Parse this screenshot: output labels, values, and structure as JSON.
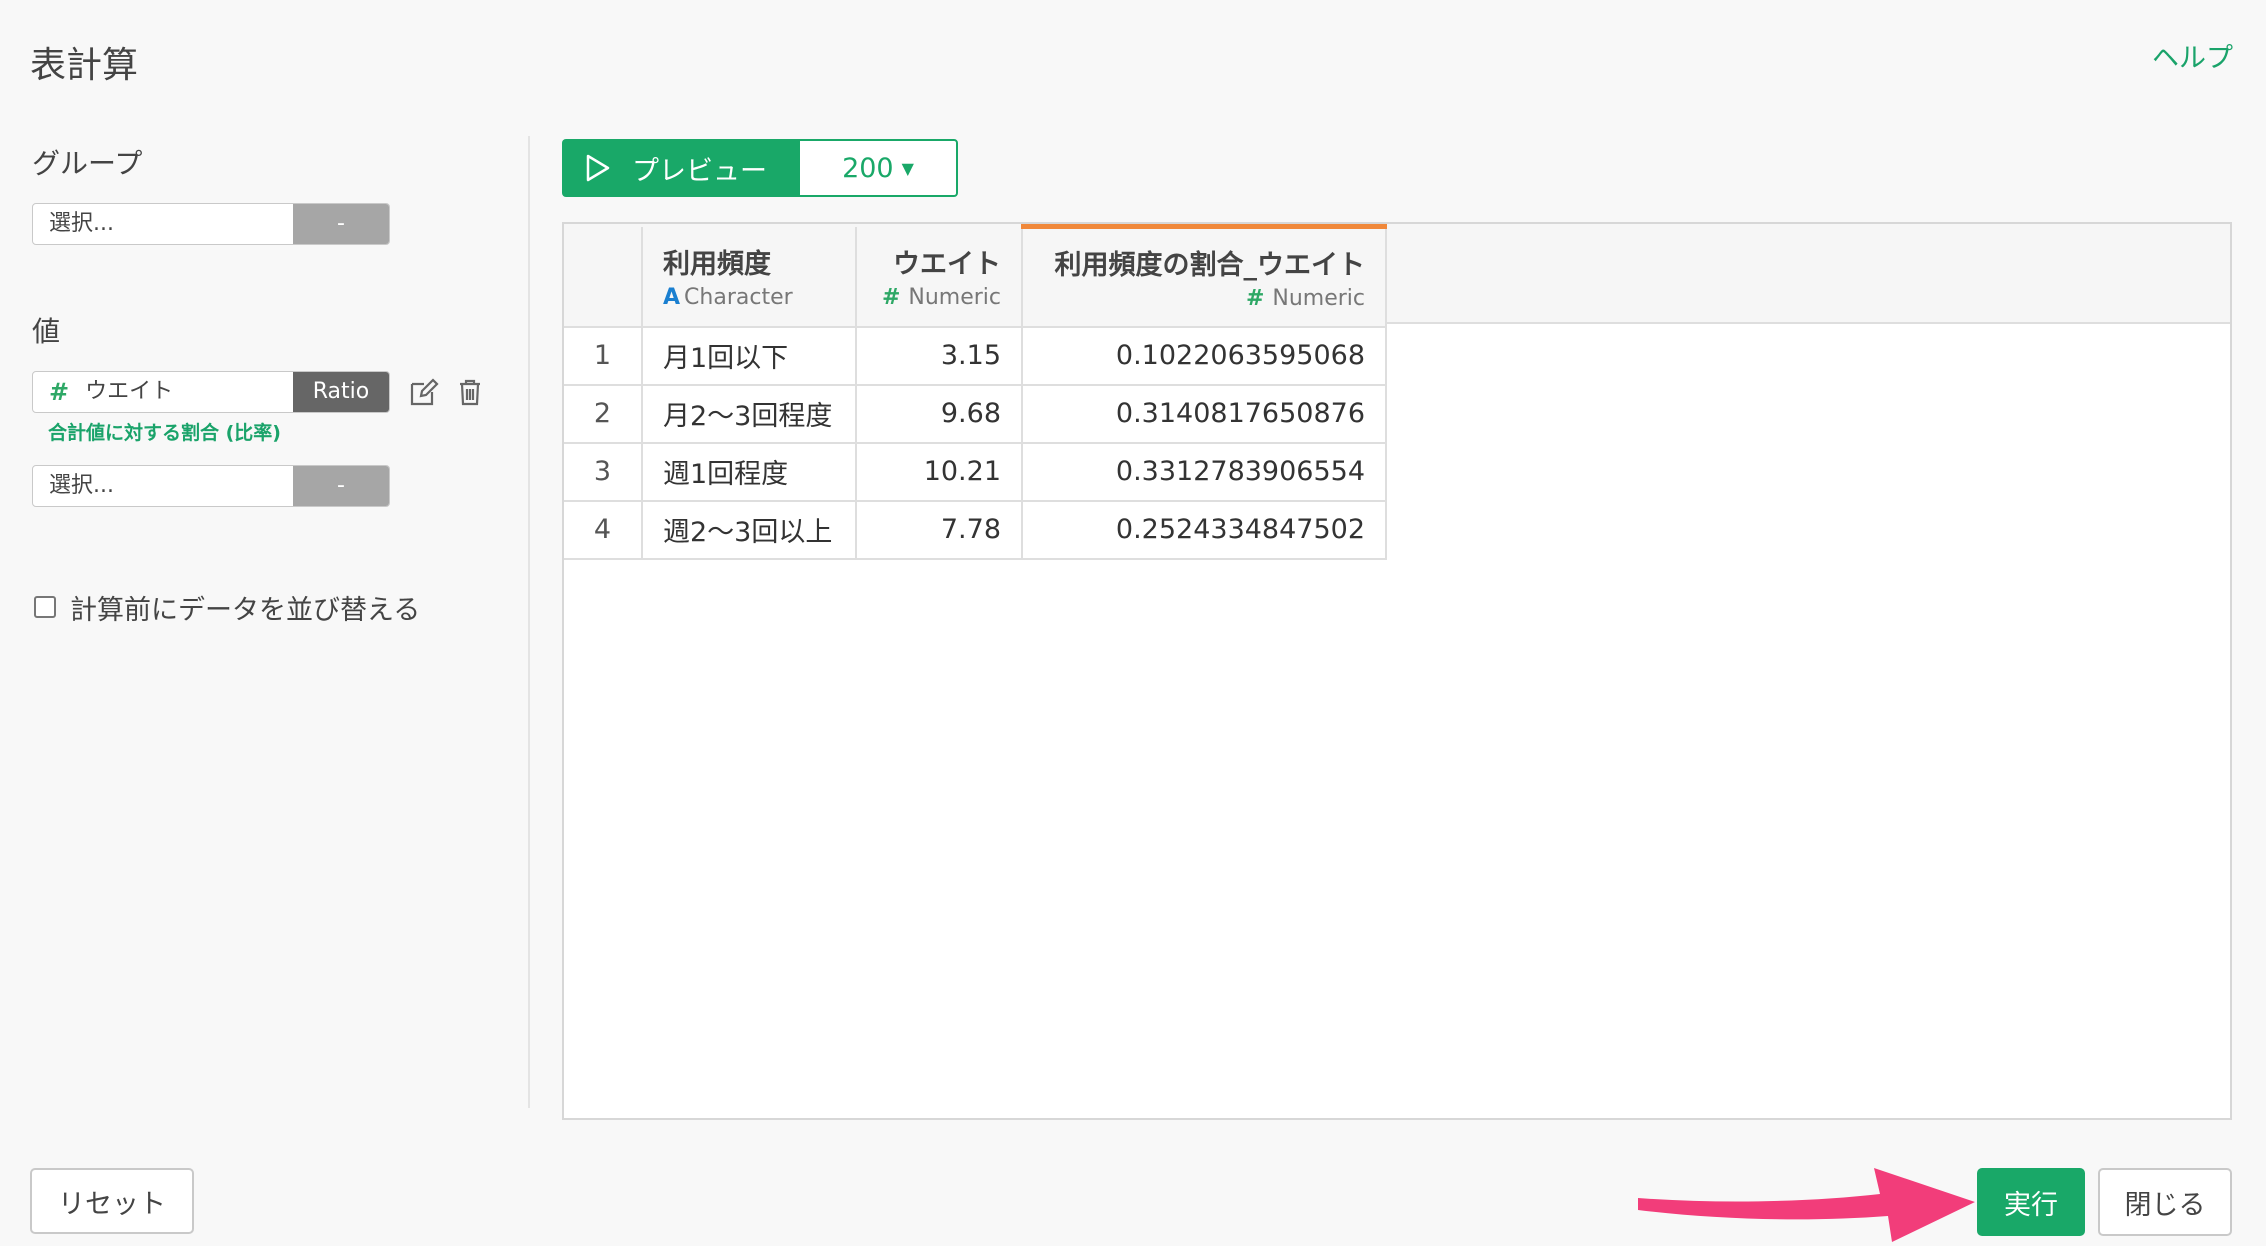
{
  "header": {
    "title": "表計算",
    "help_label": "ヘルプ"
  },
  "left_panel": {
    "group_label": "グループ",
    "group_select": {
      "placeholder": "選択...",
      "dash": "-"
    },
    "value_label": "値",
    "value_item": {
      "type_icon": "#",
      "name": "ウエイト",
      "tag": "Ratio",
      "note": "合計値に対する割合 (比率)"
    },
    "value_select": {
      "placeholder": "選択...",
      "dash": "-"
    },
    "sort_checkbox_label": "計算前にデータを並び替える"
  },
  "preview": {
    "button_label": "プレビュー",
    "row_count": "200"
  },
  "table": {
    "columns": [
      {
        "name": "利用頻度",
        "type_icon": "A",
        "type": "Character"
      },
      {
        "name": "ウエイト",
        "type_icon": "#",
        "type": "Numeric"
      },
      {
        "name": "利用頻度の割合_ウエイト",
        "type_icon": "#",
        "type": "Numeric"
      }
    ],
    "rows": [
      [
        "1",
        "月1回以下",
        "3.15",
        "0.1022063595068"
      ],
      [
        "2",
        "月2〜3回程度",
        "9.68",
        "0.3140817650876"
      ],
      [
        "3",
        "週1回程度",
        "10.21",
        "0.3312783906554"
      ],
      [
        "4",
        "週2〜3回以上",
        "7.78",
        "0.2524334847502"
      ]
    ]
  },
  "footer": {
    "reset_label": "リセット",
    "run_label": "実行",
    "close_label": "閉じる"
  },
  "colors": {
    "accent": "#19a868",
    "arrow": "#f23d7a",
    "highlight_column": "#f0883a"
  }
}
